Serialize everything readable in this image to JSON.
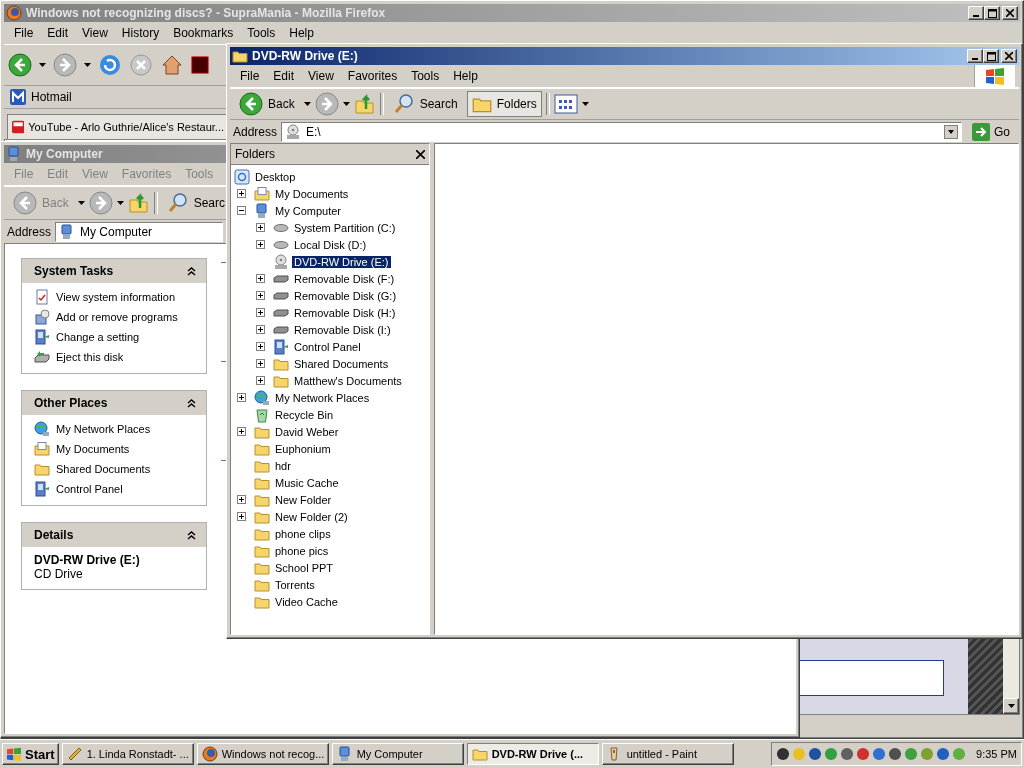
{
  "firefox": {
    "title": "Windows not recognizing discs? - SupraMania - Mozilla Firefox",
    "menu": [
      "File",
      "Edit",
      "View",
      "History",
      "Bookmarks",
      "Tools",
      "Help"
    ],
    "bookmarks": [
      "Hotmail"
    ],
    "tab": "YouTube - Arlo Guthrie/Alice's Restaur..."
  },
  "my_computer": {
    "title": "My Computer",
    "menu": [
      "File",
      "Edit",
      "View",
      "Favorites",
      "Tools"
    ],
    "back": "Back",
    "search": "Searc",
    "address_label": "Address",
    "address": "My Computer",
    "panels": [
      {
        "title": "System Tasks",
        "items": [
          {
            "label": "View system information",
            "kind": "info"
          },
          {
            "label": "Add or remove programs",
            "kind": "programs"
          },
          {
            "label": "Change a setting",
            "kind": "control"
          },
          {
            "label": "Eject this disk",
            "kind": "eject"
          }
        ]
      },
      {
        "title": "Other Places",
        "items": [
          {
            "label": "My Network Places",
            "kind": "network"
          },
          {
            "label": "My Documents",
            "kind": "documents"
          },
          {
            "label": "Shared Documents",
            "kind": "folder"
          },
          {
            "label": "Control Panel",
            "kind": "control"
          }
        ]
      }
    ],
    "details": {
      "title": "Details",
      "name": "DVD-RW Drive (E:)",
      "type": "CD Drive"
    }
  },
  "explorer": {
    "title": "DVD-RW Drive (E:)",
    "menu": [
      "File",
      "Edit",
      "View",
      "Favorites",
      "Tools",
      "Help"
    ],
    "back": "Back",
    "search": "Search",
    "folders_button": {
      "label": "Folders",
      "pressed": true
    },
    "address_label": "Address",
    "address": "E:\\",
    "go": "Go",
    "folders_title": "Folders",
    "tree": [
      {
        "label": "Desktop",
        "kind": "desktop",
        "selected": false,
        "children": [
          {
            "label": "My Documents",
            "kind": "documents",
            "expanded": false,
            "selected": false
          },
          {
            "label": "My Computer",
            "kind": "computer",
            "expanded": true,
            "selected": false,
            "children": [
              {
                "label": "System Partition (C:)",
                "kind": "drive",
                "expanded": false,
                "selected": false
              },
              {
                "label": "Local Disk (D:)",
                "kind": "drive",
                "expanded": false,
                "selected": false
              },
              {
                "label": "DVD-RW Drive (E:)",
                "kind": "dvd",
                "selected": true
              },
              {
                "label": "Removable Disk (F:)",
                "kind": "removable",
                "expanded": false,
                "selected": false
              },
              {
                "label": "Removable Disk (G:)",
                "kind": "removable",
                "expanded": false,
                "selected": false
              },
              {
                "label": "Removable Disk (H:)",
                "kind": "removable",
                "expanded": false,
                "selected": false
              },
              {
                "label": "Removable Disk (I:)",
                "kind": "removable",
                "expanded": false,
                "selected": false
              },
              {
                "label": "Control Panel",
                "kind": "control",
                "expanded": false,
                "selected": false
              },
              {
                "label": "Shared Documents",
                "kind": "folder",
                "expanded": false,
                "selected": false
              },
              {
                "label": "Matthew's Documents",
                "kind": "folder",
                "expanded": false,
                "selected": false
              }
            ]
          },
          {
            "label": "My Network Places",
            "kind": "network",
            "expanded": false,
            "selected": false
          },
          {
            "label": "Recycle Bin",
            "kind": "recycle",
            "selected": false
          },
          {
            "label": "David Weber",
            "kind": "folder",
            "expanded": false,
            "selected": false
          },
          {
            "label": "Euphonium",
            "kind": "folder",
            "selected": false
          },
          {
            "label": "hdr",
            "kind": "folder",
            "selected": false
          },
          {
            "label": "Music Cache",
            "kind": "folder",
            "selected": false
          },
          {
            "label": "New Folder",
            "kind": "folder",
            "expanded": false,
            "selected": false
          },
          {
            "label": "New Folder (2)",
            "kind": "folder",
            "expanded": false,
            "selected": false
          },
          {
            "label": "phone clips",
            "kind": "folder",
            "selected": false
          },
          {
            "label": "phone pics",
            "kind": "folder",
            "selected": false
          },
          {
            "label": "School PPT",
            "kind": "folder",
            "selected": false
          },
          {
            "label": "Torrents",
            "kind": "folder",
            "selected": false
          },
          {
            "label": "Video Cache",
            "kind": "folder",
            "selected": false
          }
        ]
      }
    ]
  },
  "taskbar": {
    "start": "Start",
    "tasks": [
      {
        "label": "1. Linda Ronstadt- ...",
        "kind": "music",
        "selected": false
      },
      {
        "label": "Windows not recog...",
        "kind": "firefox",
        "selected": false
      },
      {
        "label": "My Computer",
        "kind": "computer",
        "selected": false
      },
      {
        "label": "DVD-RW Drive (...",
        "kind": "folder",
        "selected": true
      },
      {
        "label": "untitled - Paint",
        "kind": "paint",
        "selected": false
      }
    ],
    "clock": "9:35 PM"
  }
}
